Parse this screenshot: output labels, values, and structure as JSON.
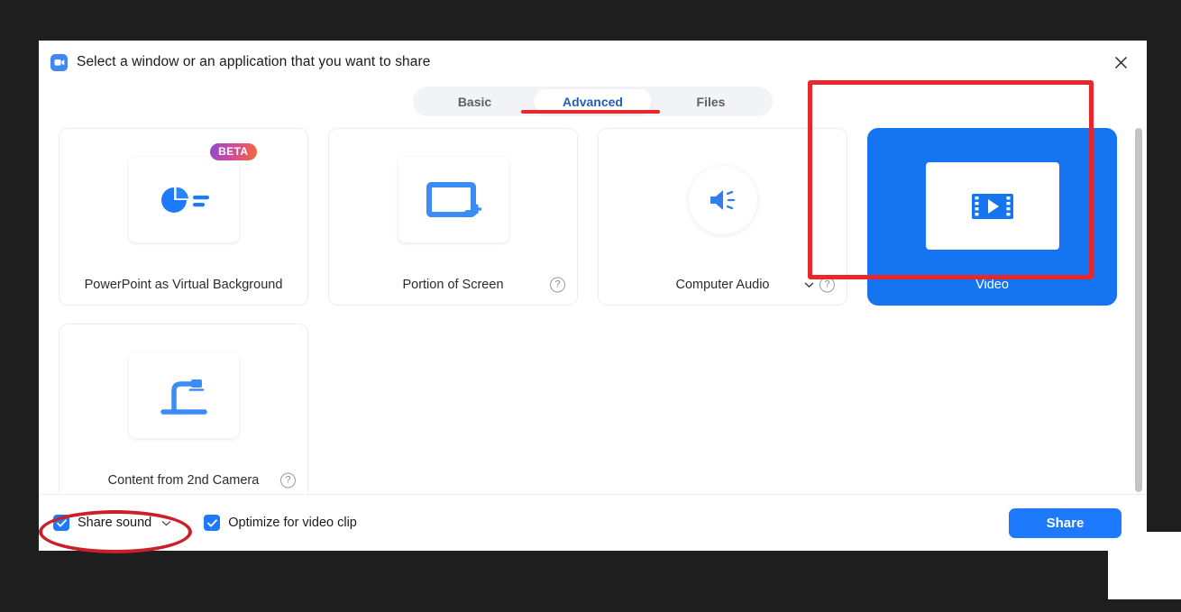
{
  "window": {
    "title": "Select a window or an application that you want to share",
    "logo_icon": "zoom-video-logo-icon",
    "close_icon": "close-icon"
  },
  "tabs": [
    {
      "label": "Basic",
      "active": false
    },
    {
      "label": "Advanced",
      "active": true
    },
    {
      "label": "Files",
      "active": false
    }
  ],
  "cards": [
    {
      "label": "PowerPoint as Virtual Background",
      "icon": "pie-chart-icon",
      "badge": "BETA",
      "selected": false,
      "has_help": false,
      "has_chevron": false
    },
    {
      "label": "Portion of Screen",
      "icon": "screen-region-plus-icon",
      "selected": false,
      "has_help": true,
      "has_chevron": false
    },
    {
      "label": "Computer Audio",
      "icon": "speaker-icon",
      "selected": false,
      "has_help": true,
      "has_chevron": true
    },
    {
      "label": "Video",
      "icon": "film-play-icon",
      "selected": true,
      "has_help": false,
      "has_chevron": false
    },
    {
      "label": "Content from 2nd Camera",
      "icon": "document-camera-icon",
      "selected": false,
      "has_help": true,
      "has_chevron": false
    }
  ],
  "footer": {
    "share_sound": {
      "label": "Share sound",
      "checked": true,
      "chevron_icon": "chevron-down-icon"
    },
    "optimize_video": {
      "label": "Optimize for video clip",
      "checked": true
    },
    "share_button": "Share"
  },
  "annotations": {
    "tab_underline_color": "#e8262b",
    "video_box_color": "#e8262b",
    "share_sound_ellipse_color": "#c9202a"
  },
  "colors": {
    "accent_blue": "#1d7afc",
    "selected_card_blue": "#1574f0",
    "active_tab_text": "#2160b8",
    "backdrop": "#1e1e1e"
  }
}
